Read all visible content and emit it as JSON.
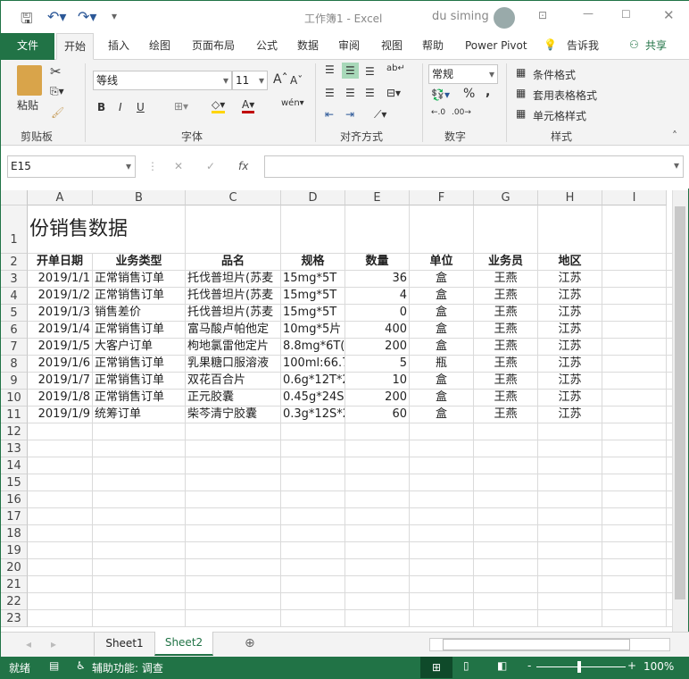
{
  "titlebar": {
    "doc_title": "工作簿1  -  Excel",
    "user": "du siming"
  },
  "tabs": [
    "文件",
    "开始",
    "插入",
    "绘图",
    "页面布局",
    "公式",
    "数据",
    "审阅",
    "视图",
    "帮助",
    "Power Pivot"
  ],
  "tell_me": "告诉我",
  "share": "共享",
  "ribbon": {
    "paste": "粘贴",
    "clipboard": "剪贴板",
    "font_name": "等线",
    "font_size": "11",
    "font": "字体",
    "bold": "B",
    "italic": "I",
    "underline": "U",
    "alignment": "对齐方式",
    "number_format": "常规",
    "number": "数字",
    "conditional": "条件格式",
    "table_format": "套用表格格式",
    "cell_style": "单元格样式",
    "styles": "样式",
    "percent": "%",
    "comma": ","
  },
  "formula_bar": {
    "name_box": "E15",
    "formula": ""
  },
  "columns": [
    "A",
    "B",
    "C",
    "D",
    "E",
    "F",
    "G",
    "H",
    "I"
  ],
  "title_cell": "份销售数据",
  "headers": [
    "开单日期",
    "业务类型",
    "品名",
    "规格",
    "数量",
    "单位",
    "业务员",
    "地区"
  ],
  "rows": [
    [
      "2019/1/1",
      "正常销售订单",
      "托伐普坦片(苏麦",
      "15mg*5T",
      "36",
      "盒",
      "王燕",
      "江苏"
    ],
    [
      "2019/1/2",
      "正常销售订单",
      "托伐普坦片(苏麦",
      "15mg*5T",
      "4",
      "盒",
      "王燕",
      "江苏"
    ],
    [
      "2019/1/3",
      "销售差价",
      "托伐普坦片(苏麦",
      "15mg*5T",
      "0",
      "盒",
      "王燕",
      "江苏"
    ],
    [
      "2019/1/4",
      "正常销售订单",
      "富马酸卢帕他定",
      "10mg*5片",
      "400",
      "盒",
      "王燕",
      "江苏"
    ],
    [
      "2019/1/5",
      "大客户订单",
      "枸地氯雷他定片",
      "8.8mg*6T(",
      "200",
      "盒",
      "王燕",
      "江苏"
    ],
    [
      "2019/1/6",
      "正常销售订单",
      "乳果糖口服溶液",
      "100ml:66.7",
      "5",
      "瓶",
      "王燕",
      "江苏"
    ],
    [
      "2019/1/7",
      "正常销售订单",
      "双花百合片",
      "0.6g*12T*2",
      "10",
      "盒",
      "王燕",
      "江苏"
    ],
    [
      "2019/1/8",
      "正常销售订单",
      "正元胶囊",
      "0.45g*24S",
      "200",
      "盒",
      "王燕",
      "江苏"
    ],
    [
      "2019/1/9",
      "统筹订单",
      "柴芩清宁胶囊",
      "0.3g*12S*2",
      "60",
      "盒",
      "王燕",
      "江苏"
    ]
  ],
  "row_numbers": [
    "1",
    "2",
    "3",
    "4",
    "5",
    "6",
    "7",
    "8",
    "9",
    "10",
    "11",
    "12",
    "13",
    "14",
    "15",
    "16",
    "17",
    "18",
    "19",
    "20",
    "21",
    "22",
    "23"
  ],
  "sheets": [
    "Sheet1",
    "Sheet2"
  ],
  "active_sheet": "Sheet2",
  "status": {
    "ready": "就绪",
    "accessibility": "辅助功能: 调查",
    "zoom": "100%",
    "zoom_level": 100
  },
  "colors": {
    "accent": "#217346"
  }
}
